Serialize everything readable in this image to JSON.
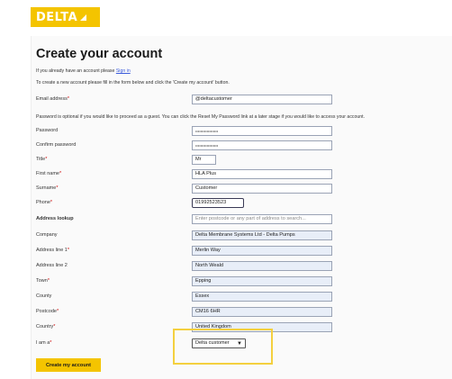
{
  "logo": {
    "text": "DELTA"
  },
  "page": {
    "title": "Create your account",
    "have_account_prefix": "If you already have an account please",
    "sign_in_link": "Sign in",
    "instructions": "To create a new account please fill in the form below and click the 'Create my account' button.",
    "password_note": "Password is optional if you would like to proceed as a guest. You can click the Reset My Password link at a later stage if you would like to access your account."
  },
  "form": {
    "email": {
      "label": "Email address",
      "value": "@deltacustomer"
    },
    "password": {
      "label": "Password",
      "value": "••••••••••••••••••"
    },
    "confirm_password": {
      "label": "Confirm password",
      "value": "••••••••••••••••••"
    },
    "title": {
      "label": "Title",
      "value": "Mr"
    },
    "first_name": {
      "label": "First name",
      "value": "HLA Plus"
    },
    "surname": {
      "label": "Surname",
      "value": "Customer"
    },
    "phone": {
      "label": "Phone",
      "value": "01992523523"
    },
    "address_lookup": {
      "label": "Address lookup",
      "placeholder": "Enter postcode or any part of address to search..."
    },
    "company": {
      "label": "Company",
      "value": "Delta Membrane Systems Ltd - Delta Pumps"
    },
    "address1": {
      "label": "Address line 1",
      "value": "Merlin Way"
    },
    "address2": {
      "label": "Address line 2",
      "value": "North Weald"
    },
    "town": {
      "label": "Town",
      "value": "Epping"
    },
    "county": {
      "label": "County",
      "value": "Essex"
    },
    "postcode": {
      "label": "Postcode",
      "value": "CM16 6HR"
    },
    "country": {
      "label": "Country",
      "value": "United Kingdom"
    },
    "i_am_a": {
      "label": "I am a",
      "selected": "Delta customer"
    },
    "submit_label": "Create my account"
  },
  "colors": {
    "brand_yellow": "#f4c400",
    "highlight": "#f4d03f",
    "link": "#3b5bdb"
  }
}
